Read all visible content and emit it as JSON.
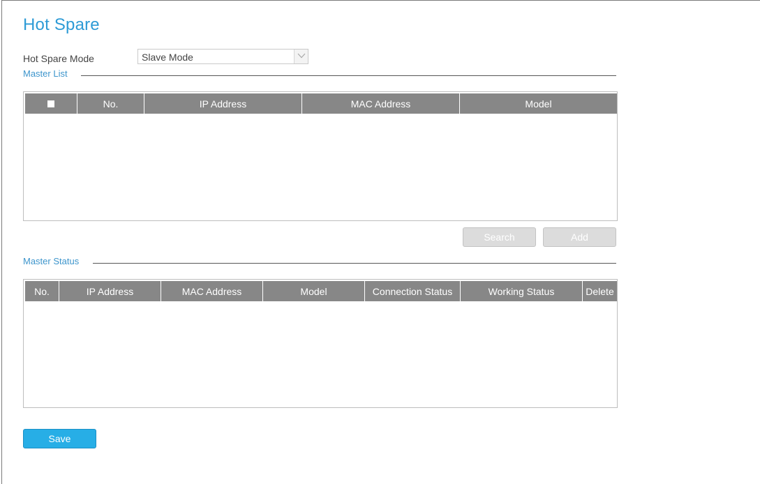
{
  "page": {
    "title": "Hot Spare"
  },
  "mode": {
    "label": "Hot Spare Mode",
    "selected": "Slave Mode"
  },
  "master_list": {
    "title": "Master List",
    "columns": [
      "No.",
      "IP Address",
      "MAC Address",
      "Model"
    ],
    "rows": []
  },
  "actions": {
    "search_label": "Search",
    "add_label": "Add"
  },
  "master_status": {
    "title": "Master Status",
    "columns": [
      "No.",
      "IP Address",
      "MAC Address",
      "Model",
      "Connection Status",
      "Working Status",
      "Delete"
    ],
    "rows": []
  },
  "save_label": "Save",
  "colors": {
    "accent": "#2e9bd6",
    "header_bg": "#878787",
    "save_button": "#27aee6",
    "disabled_button": "#dcdcdc"
  }
}
